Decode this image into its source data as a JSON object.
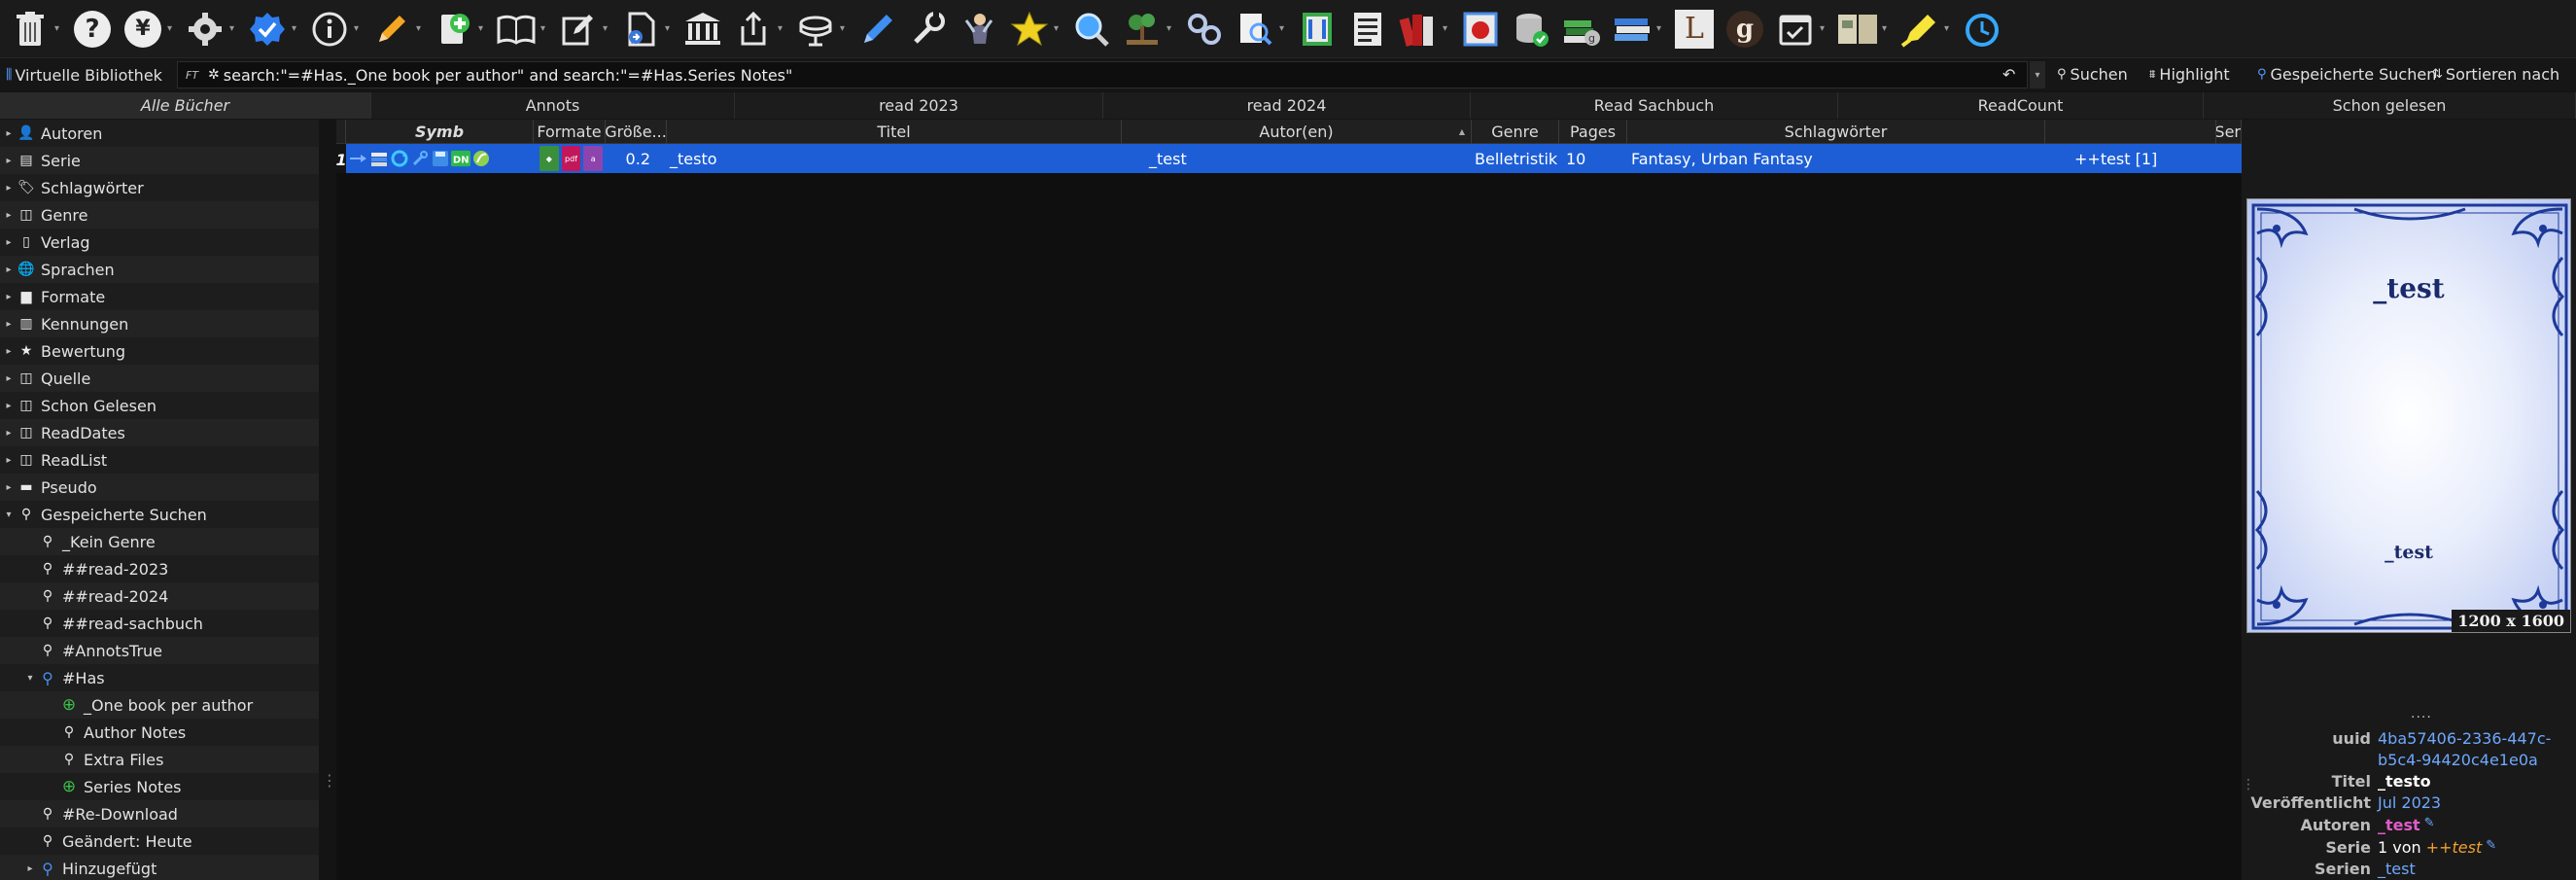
{
  "toolbar": {
    "icons": [
      {
        "name": "trash-icon",
        "caret": true
      },
      {
        "name": "help-icon",
        "caret": false
      },
      {
        "name": "yen-icon",
        "caret": true
      },
      {
        "name": "gear-icon",
        "caret": true
      },
      {
        "name": "verified-badge-icon",
        "caret": true
      },
      {
        "name": "info-icon",
        "caret": true
      },
      {
        "name": "pencil-icon",
        "caret": true
      },
      {
        "name": "add-book-icon",
        "caret": true
      },
      {
        "name": "open-book-icon",
        "caret": true
      },
      {
        "name": "edit-square-icon",
        "caret": true
      },
      {
        "name": "convert-document-icon",
        "caret": true
      },
      {
        "name": "library-icon",
        "caret": false
      },
      {
        "name": "share-icon",
        "caret": true
      },
      {
        "name": "device-icon",
        "caret": true
      },
      {
        "name": "pen-icon",
        "caret": false
      },
      {
        "name": "wrench-icon",
        "caret": false
      },
      {
        "name": "fairy-icon",
        "caret": false
      },
      {
        "name": "star-icon",
        "caret": true
      },
      {
        "name": "magnifier-icon",
        "caret": false
      },
      {
        "name": "tree-icon",
        "caret": true
      },
      {
        "name": "link-icon",
        "caret": false
      },
      {
        "name": "search-document-icon",
        "caret": true
      },
      {
        "name": "column-book-icon",
        "caret": false
      },
      {
        "name": "list-book-icon",
        "caret": false
      },
      {
        "name": "books-icon",
        "caret": true
      },
      {
        "name": "photo-book-icon",
        "caret": false
      },
      {
        "name": "database-icon",
        "caret": false
      },
      {
        "name": "goodreads-books-icon",
        "caret": false
      },
      {
        "name": "book-stack-icon",
        "caret": true
      },
      {
        "name": "letter-l-icon",
        "caret": false
      },
      {
        "name": "letter-g-icon",
        "caret": false
      },
      {
        "name": "calendar-check-icon",
        "caret": true
      },
      {
        "name": "open-pages-icon",
        "caret": true
      },
      {
        "name": "highlighter-icon",
        "caret": true
      },
      {
        "name": "clock-icon",
        "caret": false
      }
    ],
    "letter_l": "L",
    "letter_g": "g"
  },
  "searchbar": {
    "library_label": "Virtuelle Bibliothek",
    "query": "search:\"=#Has._One book per author\" and search:\"=#Has.Series Notes\"",
    "ft_label": "FT",
    "search_label": "Suchen",
    "highlight_label": "Highlight",
    "saved_searches_label": "Gespeicherte Suchen",
    "sort_label": "Sortieren nach"
  },
  "tabs": [
    "Alle Bücher",
    "Annots",
    "read 2023",
    "read 2024",
    "Read Sachbuch",
    "ReadCount",
    "Schon gelesen"
  ],
  "sidebar": {
    "items": [
      {
        "label": "Autoren",
        "icon": "person-icon",
        "glyph": "👤",
        "arrow": "▸",
        "indent": 0
      },
      {
        "label": "Serie",
        "icon": "series-icon",
        "glyph": "▤",
        "arrow": "▸",
        "indent": 0
      },
      {
        "label": "Schlagwörter",
        "icon": "tag-icon",
        "glyph": "🏷",
        "arrow": "▸",
        "indent": 0
      },
      {
        "label": "Genre",
        "icon": "column-icon",
        "glyph": "◫",
        "arrow": "▸",
        "indent": 0
      },
      {
        "label": "Verlag",
        "icon": "publisher-icon",
        "glyph": "▯",
        "arrow": "▸",
        "indent": 0
      },
      {
        "label": "Sprachen",
        "icon": "globe-icon",
        "glyph": "🌐",
        "arrow": "▸",
        "indent": 0
      },
      {
        "label": "Formate",
        "icon": "format-icon",
        "glyph": "▆",
        "arrow": "▸",
        "indent": 0
      },
      {
        "label": "Kennungen",
        "icon": "barcode-icon",
        "glyph": "▥",
        "arrow": "▸",
        "indent": 0
      },
      {
        "label": "Bewertung",
        "icon": "rating-star-icon",
        "glyph": "★",
        "arrow": "▸",
        "indent": 0
      },
      {
        "label": "Quelle",
        "icon": "column-icon",
        "glyph": "◫",
        "arrow": "▸",
        "indent": 0
      },
      {
        "label": "Schon Gelesen",
        "icon": "column-icon",
        "glyph": "◫",
        "arrow": "▸",
        "indent": 0
      },
      {
        "label": "ReadDates",
        "icon": "column-icon",
        "glyph": "◫",
        "arrow": "▸",
        "indent": 0
      },
      {
        "label": "ReadList",
        "icon": "column-icon",
        "glyph": "◫",
        "arrow": "▸",
        "indent": 0
      },
      {
        "label": "Pseudo",
        "icon": "drive-icon",
        "glyph": "▬",
        "arrow": "▸",
        "indent": 0
      },
      {
        "label": "Gespeicherte Suchen",
        "icon": "search-icon",
        "glyph": "⚲",
        "arrow": "▾",
        "indent": 0
      },
      {
        "label": "_Kein Genre",
        "icon": "search-icon",
        "glyph": "⚲",
        "arrow": "",
        "indent": 1
      },
      {
        "label": "##read-2023",
        "icon": "search-icon",
        "glyph": "⚲",
        "arrow": "",
        "indent": 1
      },
      {
        "label": "##read-2024",
        "icon": "search-icon",
        "glyph": "⚲",
        "arrow": "",
        "indent": 1
      },
      {
        "label": "##read-sachbuch",
        "icon": "search-icon",
        "glyph": "⚲",
        "arrow": "",
        "indent": 1
      },
      {
        "label": "#AnnotsTrue",
        "icon": "search-icon",
        "glyph": "⚲",
        "arrow": "",
        "indent": 1
      },
      {
        "label": "#Has",
        "icon": "search-blue-icon",
        "glyph": "⚲",
        "arrow": "▾",
        "indent": 1
      },
      {
        "label": "_One book per author",
        "icon": "plus-circle-icon",
        "glyph": "⊕",
        "arrow": "",
        "indent": 2
      },
      {
        "label": "Author Notes",
        "icon": "search-icon",
        "glyph": "⚲",
        "arrow": "",
        "indent": 2
      },
      {
        "label": "Extra Files",
        "icon": "search-icon",
        "glyph": "⚲",
        "arrow": "",
        "indent": 2
      },
      {
        "label": "Series Notes",
        "icon": "plus-circle-icon",
        "glyph": "⊕",
        "arrow": "",
        "indent": 2
      },
      {
        "label": "#Re-Download",
        "icon": "search-icon",
        "glyph": "⚲",
        "arrow": "",
        "indent": 1
      },
      {
        "label": "Geändert: Heute",
        "icon": "search-icon",
        "glyph": "⚲",
        "arrow": "",
        "indent": 1
      },
      {
        "label": "Hinzugefügt",
        "icon": "search-blue-icon",
        "glyph": "⚲",
        "arrow": "▸",
        "indent": 1
      }
    ]
  },
  "table": {
    "columns": [
      "Symb",
      "Formate",
      "Größe...",
      "Titel",
      "Autor(en)",
      "Genre",
      "Pages",
      "Schlagwörter",
      "",
      "Ser"
    ],
    "sort_indicator": "▲",
    "row": {
      "num": "1",
      "size": "0.2",
      "title": "_testo",
      "author": "_test",
      "genre": "Belletristik",
      "pages": "10",
      "tags": "Fantasy, Urban Fantasy",
      "series": "++test [1]"
    },
    "format_badges": [
      {
        "color": "#3b8f3b",
        "text": "⬛"
      },
      {
        "color": "#c2185b",
        "text": "pdf"
      },
      {
        "color": "#8e44ad",
        "text": "a"
      }
    ]
  },
  "details": {
    "cover_title": "_test",
    "cover_author": "_test",
    "cover_size": "1200 x 1600",
    "ellipsis": "....",
    "fields": [
      {
        "key": "uuid",
        "value": "4ba57406-2336-447c-",
        "style": "link"
      },
      {
        "key": "",
        "value": "b5c4-94420c4e1e0a",
        "style": "link"
      },
      {
        "key": "Titel",
        "value": "_testo",
        "style": "white"
      },
      {
        "key": "Veröffentlicht",
        "value": "Jul 2023",
        "style": "link"
      },
      {
        "key": "Autoren",
        "value": "_test",
        "style": "pink"
      },
      {
        "key": "Serie",
        "value": "1 von",
        "style": "white-normal",
        "extra": "++test"
      },
      {
        "key": "Serien Autoren",
        "value": "_test",
        "style": "link"
      }
    ]
  }
}
